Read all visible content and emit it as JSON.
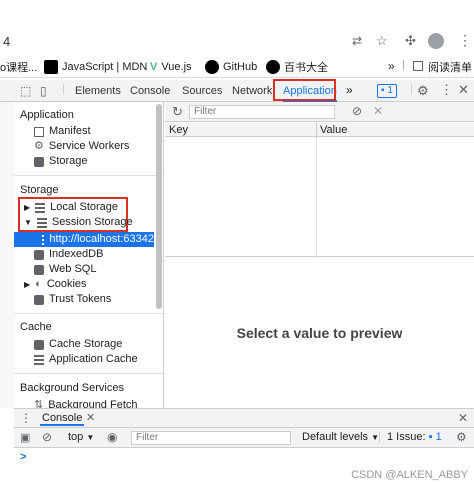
{
  "browser": {
    "address_fragment": "4",
    "bookmarks": [
      {
        "label": "o课程...",
        "icon": "bookmark-icon",
        "color": "#f0a030"
      },
      {
        "label": "JavaScript | MDN",
        "icon": "mdn-icon",
        "color": "#000000"
      },
      {
        "label": "Vue.js",
        "icon": "vue-icon",
        "color": "#42b883"
      },
      {
        "label": "GitHub",
        "icon": "github-icon",
        "color": "#000000"
      },
      {
        "label": "百书大全",
        "icon": "github-icon",
        "color": "#000000"
      }
    ],
    "overflow": "»",
    "reading_list": "阅读清单"
  },
  "devtools": {
    "tabs": [
      "Elements",
      "Console",
      "Sources",
      "Network",
      "Application"
    ],
    "active_tab": "Application",
    "more": "»",
    "issues_count": "1"
  },
  "sidebar": {
    "application_title": "Application",
    "application_items": [
      "Manifest",
      "Service Workers",
      "Storage"
    ],
    "storage_title": "Storage",
    "local_storage": "Local Storage",
    "session_storage": "Session Storage",
    "session_child": "http://localhost:63342",
    "storage_items": [
      "IndexedDB",
      "Web SQL",
      "Cookies",
      "Trust Tokens"
    ],
    "cache_title": "Cache",
    "cache_items": [
      "Cache Storage",
      "Application Cache"
    ],
    "bg_title": "Background Services",
    "bg_items": [
      "Background Fetch"
    ]
  },
  "main": {
    "filter_placeholder": "Filter",
    "col_key": "Key",
    "col_value": "Value",
    "preview_text": "Select a value to preview"
  },
  "drawer": {
    "tab": "Console",
    "context": "top",
    "filter_placeholder": "Filter",
    "levels": "Default levels",
    "issue_label": "1 Issue:",
    "issue_count": "1",
    "prompt": ">"
  },
  "watermark": "CSDN @ALKEN_ABBY",
  "colors": {
    "accent": "#1a73e8",
    "highlight_box": "#d93025"
  }
}
